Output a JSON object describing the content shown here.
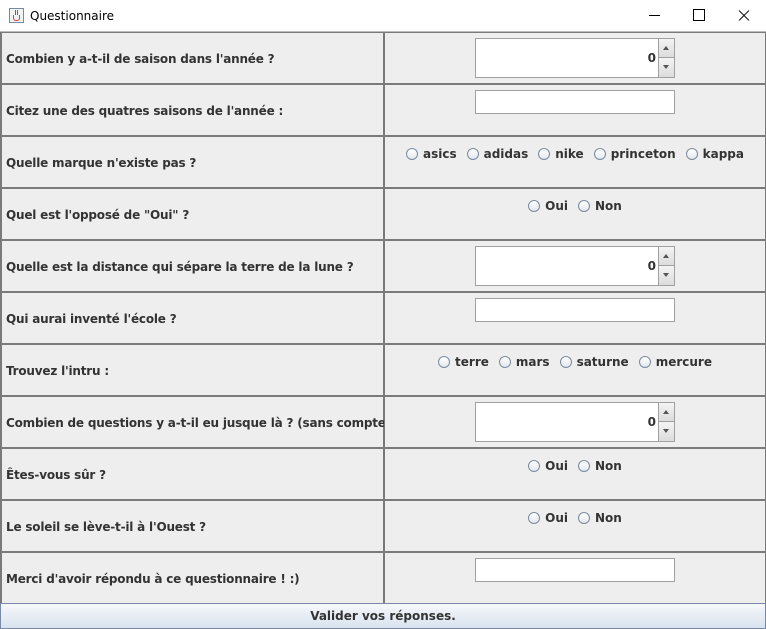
{
  "window": {
    "title": "Questionnaire"
  },
  "questions": [
    {
      "label": "Combien y a-t-il de saison dans l'année ?",
      "type": "spinner",
      "value": "0"
    },
    {
      "label": "Citez une des quatres saisons de l'année :",
      "type": "text",
      "value": ""
    },
    {
      "label": "Quelle marque n'existe pas ?",
      "type": "radio",
      "options": [
        "asics",
        "adidas",
        "nike",
        "princeton",
        "kappa"
      ]
    },
    {
      "label": "Quel est l'opposé de \"Oui\" ?",
      "type": "radio",
      "options": [
        "Oui",
        "Non"
      ]
    },
    {
      "label": "Quelle est la distance qui sépare la terre de la lune ?",
      "type": "spinner",
      "value": "0"
    },
    {
      "label": "Qui aurai inventé l'école ?",
      "type": "text",
      "value": ""
    },
    {
      "label": "Trouvez l'intru :",
      "type": "radio",
      "options": [
        "terre",
        "mars",
        "saturne",
        "mercure"
      ]
    },
    {
      "label": "Combien de questions y a-t-il eu jusque là ? (sans compter celle-ci)",
      "type": "spinner",
      "value": "0"
    },
    {
      "label": "Êtes-vous sûr ?",
      "type": "radio",
      "options": [
        "Oui",
        "Non"
      ]
    },
    {
      "label": "Le soleil se lève-t-il à l'Ouest ?",
      "type": "radio",
      "options": [
        "Oui",
        "Non"
      ]
    },
    {
      "label": "Merci d'avoir répondu à ce questionnaire ! :)",
      "type": "text",
      "value": ""
    }
  ],
  "submit_label": "Valider vos réponses."
}
